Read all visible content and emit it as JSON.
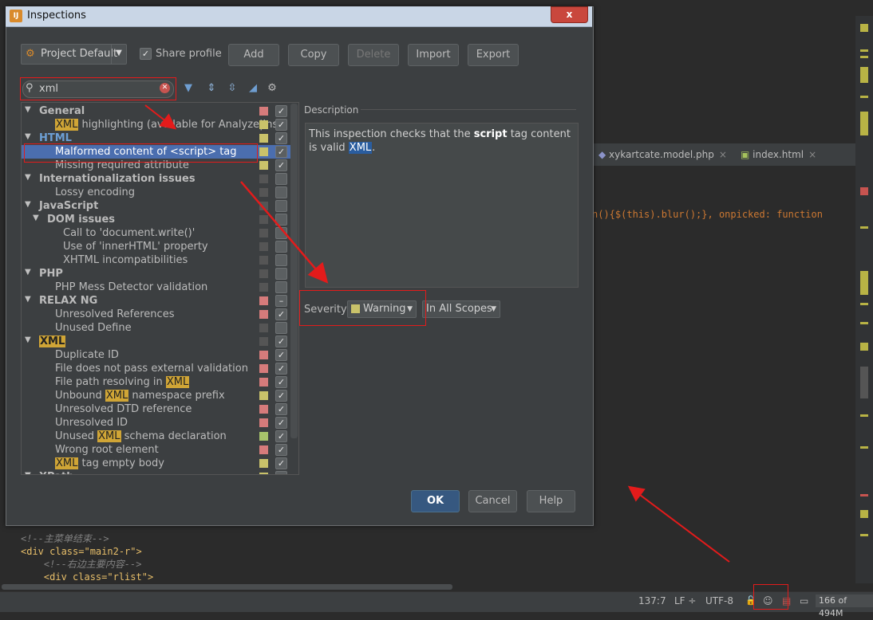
{
  "dialog": {
    "title": "Inspections",
    "close_glyph": "x",
    "profile": "Project Default",
    "share_profile_label": "Share profile",
    "share_profile_checked": true,
    "buttons": {
      "add": "Add",
      "copy": "Copy",
      "delete": "Delete",
      "import": "Import",
      "export": "Export"
    },
    "search_value": "xml",
    "description_label": "Description",
    "description": {
      "before": "This inspection checks that the ",
      "bold": "script",
      "middle": " tag content is valid ",
      "highlight": "XML",
      "after": "."
    },
    "severity_label": "Severity:",
    "severity_value": "Warning",
    "scope_value": "In All Scopes",
    "ok": "OK",
    "cancel": "Cancel",
    "help": "Help"
  },
  "tree": [
    {
      "indent": 0,
      "expand": true,
      "bold": true,
      "text": "General",
      "sev": "error",
      "checked": true
    },
    {
      "indent": 2,
      "hl": "XML",
      "text": " highlighting (available for Analyze|Insp",
      "sev": "warn",
      "checked": true
    },
    {
      "indent": 0,
      "expand": true,
      "bold": true,
      "blue": true,
      "text": "HTML",
      "sev": "warn",
      "checked": true
    },
    {
      "indent": 2,
      "text": "Malformed content of <script> tag",
      "sev": "warn",
      "checked": true,
      "selected": true
    },
    {
      "indent": 2,
      "text": "Missing required attribute",
      "sev": "warn",
      "checked": true
    },
    {
      "indent": 0,
      "expand": true,
      "bold": true,
      "text": "Internationalization issues",
      "sev": "none",
      "checked": false
    },
    {
      "indent": 2,
      "text": "Lossy encoding",
      "sev": "none",
      "checked": false
    },
    {
      "indent": 0,
      "expand": true,
      "bold": true,
      "text": "JavaScript",
      "sev": "none",
      "checked": false
    },
    {
      "indent": 1,
      "expand": true,
      "bold": true,
      "text": "DOM issues",
      "sev": "none",
      "checked": false
    },
    {
      "indent": 3,
      "text": "Call to 'document.write()'",
      "sev": "none",
      "checked": false
    },
    {
      "indent": 3,
      "text": "Use of 'innerHTML' property",
      "sev": "none",
      "checked": false
    },
    {
      "indent": 3,
      "text": "XHTML incompatibilities",
      "sev": "none",
      "checked": false
    },
    {
      "indent": 0,
      "expand": true,
      "bold": true,
      "text": "PHP",
      "sev": "none",
      "checked": false
    },
    {
      "indent": 2,
      "text": "PHP Mess Detector validation",
      "sev": "none",
      "checked": false
    },
    {
      "indent": 0,
      "expand": true,
      "bold": true,
      "text": "RELAX NG",
      "sev": "error",
      "checked": "partial"
    },
    {
      "indent": 2,
      "text": "Unresolved References",
      "sev": "error",
      "checked": true
    },
    {
      "indent": 2,
      "text": "Unused Define",
      "sev": "none",
      "checked": false
    },
    {
      "indent": 0,
      "expand": true,
      "bold": true,
      "hlonly": true,
      "text": "XML",
      "sev": "none",
      "checked": true
    },
    {
      "indent": 2,
      "text": "Duplicate ID",
      "sev": "error",
      "checked": true
    },
    {
      "indent": 2,
      "text": "File does not pass external validation",
      "sev": "error",
      "checked": true
    },
    {
      "indent": 2,
      "text": "File path resolving in ",
      "hl_after": "XML",
      "sev": "error",
      "checked": true
    },
    {
      "indent": 2,
      "text": "Unbound ",
      "hl_mid": "XML",
      "text2": " namespace prefix",
      "sev": "warn",
      "checked": true
    },
    {
      "indent": 2,
      "text": "Unresolved DTD reference",
      "sev": "error",
      "checked": true
    },
    {
      "indent": 2,
      "text": "Unresolved ID",
      "sev": "error",
      "checked": true
    },
    {
      "indent": 2,
      "text": "Unused ",
      "hl_mid": "XML",
      "text2": " schema declaration",
      "sev": "green",
      "checked": true
    },
    {
      "indent": 2,
      "text": "Wrong root element",
      "sev": "error",
      "checked": true
    },
    {
      "indent": 2,
      "hl": "XML",
      "text": " tag empty body",
      "sev": "warn",
      "checked": true
    },
    {
      "indent": 0,
      "expand": true,
      "bold": true,
      "text": "XPath",
      "sev": "warn",
      "checked": true
    }
  ],
  "editor": {
    "tabs": [
      {
        "label": "xykartcate.model.php",
        "close": "×"
      },
      {
        "label": "index.html",
        "close": "×"
      }
    ],
    "code_right": "n(){$(this).blur();}, onpicked: function",
    "code_bottom": [
      "<!--主菜单结束-->",
      "<div class=\"main2-r\">",
      "    <!--右边主要内容-->",
      "    <div class=\"rlist\">"
    ]
  },
  "status": {
    "position": "137:7",
    "line_sep": "LF ÷",
    "encoding": "UTF-8",
    "memory": "166 of 494M"
  },
  "colors": {
    "error": "#d67b7b",
    "warn": "#c9c26a",
    "green": "#a7c36b",
    "none": "#555555"
  }
}
